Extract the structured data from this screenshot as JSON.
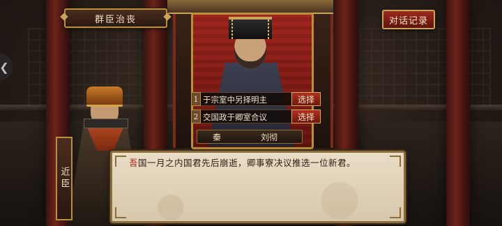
{
  "header": {
    "title": "群臣治丧",
    "log_button": "对话记录"
  },
  "choices": [
    {
      "num": "1",
      "text": "于宗室中另择明主",
      "action": "选择"
    },
    {
      "num": "2",
      "text": "交国政于卿室合议",
      "action": "选择"
    }
  ],
  "speaker": {
    "state": "秦",
    "name": "刘彻"
  },
  "minister": {
    "role": "近臣"
  },
  "dialog": {
    "lead": "吾",
    "text": "国一月之内国君先后崩逝，卿事寮决议推选一位新君。"
  },
  "icons": {
    "side_arrow": "chevron-left-icon"
  }
}
